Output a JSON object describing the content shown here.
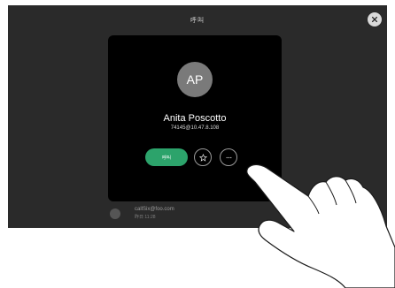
{
  "header": {
    "title": "呼叫"
  },
  "contact": {
    "initials": "AP",
    "name": "Anita Poscotto",
    "address": "74145@10.47.8.108"
  },
  "actions": {
    "call_label": "呼叫",
    "favorite_icon": "star-icon",
    "more_icon": "more-icon",
    "close_icon": "close-icon"
  },
  "recent": {
    "name": "callSix@foo.com",
    "detail": "昨日 11:28"
  },
  "colors": {
    "screen_bg": "#2a2a2a",
    "card_bg": "#000000",
    "call_green": "#2ca36b",
    "avatar_gray": "#7a7a7a"
  }
}
